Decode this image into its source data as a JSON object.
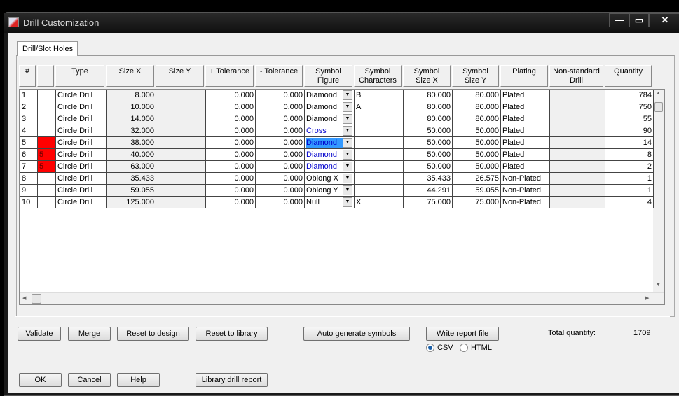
{
  "window": {
    "title": "Drill Customization",
    "minimize": "—",
    "maximize": "▭",
    "close": "✕"
  },
  "tab": "Drill/Slot Holes",
  "columns": [
    "#",
    "",
    "Type",
    "Size X",
    "Size Y",
    "+ Tolerance",
    "- Tolerance",
    "Symbol\nFigure",
    "Symbol\nCharacters",
    "Symbol\nSize X",
    "Symbol\nSize Y",
    "Plating",
    "Non-standard\nDrill",
    "Quantity"
  ],
  "rows": [
    {
      "n": "1",
      "mark": "",
      "markColor": "",
      "type": "Circle Drill",
      "sx": "8.000",
      "sy": "",
      "pt": "0.000",
      "mt": "0.000",
      "fig": "Diamond",
      "figStyle": "normal",
      "chars": "B",
      "ssx": "80.000",
      "ssy": "80.000",
      "plating": "Plated",
      "ns": "",
      "qty": "784"
    },
    {
      "n": "2",
      "mark": "",
      "markColor": "",
      "type": "Circle Drill",
      "sx": "10.000",
      "sy": "",
      "pt": "0.000",
      "mt": "0.000",
      "fig": "Diamond",
      "figStyle": "normal",
      "chars": "A",
      "ssx": "80.000",
      "ssy": "80.000",
      "plating": "Plated",
      "ns": "",
      "qty": "750"
    },
    {
      "n": "3",
      "mark": "",
      "markColor": "",
      "type": "Circle Drill",
      "sx": "14.000",
      "sy": "",
      "pt": "0.000",
      "mt": "0.000",
      "fig": "Diamond",
      "figStyle": "normal",
      "chars": "",
      "ssx": "80.000",
      "ssy": "80.000",
      "plating": "Plated",
      "ns": "",
      "qty": "55"
    },
    {
      "n": "4",
      "mark": "",
      "markColor": "",
      "type": "Circle Drill",
      "sx": "32.000",
      "sy": "",
      "pt": "0.000",
      "mt": "0.000",
      "fig": "Cross",
      "figStyle": "blue",
      "chars": "",
      "ssx": "50.000",
      "ssy": "50.000",
      "plating": "Plated",
      "ns": "",
      "qty": "90"
    },
    {
      "n": "5",
      "mark": "",
      "markColor": "#ff0000",
      "type": "Circle Drill",
      "sx": "38.000",
      "sy": "",
      "pt": "0.000",
      "mt": "0.000",
      "fig": "Diamond",
      "figStyle": "selected",
      "chars": "",
      "ssx": "50.000",
      "ssy": "50.000",
      "plating": "Plated",
      "ns": "",
      "qty": "14"
    },
    {
      "n": "6",
      "mark": "5",
      "markColor": "#ff0000",
      "type": "Circle Drill",
      "sx": "40.000",
      "sy": "",
      "pt": "0.000",
      "mt": "0.000",
      "fig": "Diamond",
      "figStyle": "blue",
      "chars": "",
      "ssx": "50.000",
      "ssy": "50.000",
      "plating": "Plated",
      "ns": "",
      "qty": "8"
    },
    {
      "n": "7",
      "mark": "5",
      "markColor": "#ff0000",
      "type": "Circle Drill",
      "sx": "63.000",
      "sy": "",
      "pt": "0.000",
      "mt": "0.000",
      "fig": "Diamond",
      "figStyle": "blue",
      "chars": "",
      "ssx": "50.000",
      "ssy": "50.000",
      "plating": "Plated",
      "ns": "",
      "qty": "2"
    },
    {
      "n": "8",
      "mark": "",
      "markColor": "",
      "type": "Circle Drill",
      "sx": "35.433",
      "sy": "",
      "pt": "0.000",
      "mt": "0.000",
      "fig": "Oblong X",
      "figStyle": "normal",
      "chars": "",
      "ssx": "35.433",
      "ssy": "26.575",
      "plating": "Non-Plated",
      "ns": "",
      "qty": "1"
    },
    {
      "n": "9",
      "mark": "",
      "markColor": "",
      "type": "Circle Drill",
      "sx": "59.055",
      "sy": "",
      "pt": "0.000",
      "mt": "0.000",
      "fig": "Oblong Y",
      "figStyle": "normal",
      "chars": "",
      "ssx": "44.291",
      "ssy": "59.055",
      "plating": "Non-Plated",
      "ns": "",
      "qty": "1"
    },
    {
      "n": "10",
      "mark": "",
      "markColor": "",
      "type": "Circle Drill",
      "sx": "125.000",
      "sy": "",
      "pt": "0.000",
      "mt": "0.000",
      "fig": "Null",
      "figStyle": "normal",
      "chars": "X",
      "ssx": "75.000",
      "ssy": "75.000",
      "plating": "Non-Plated",
      "ns": "",
      "qty": "4"
    }
  ],
  "buttons": {
    "validate": "Validate",
    "merge": "Merge",
    "reset_design": "Reset to design",
    "reset_library": "Reset to library",
    "auto_generate": "Auto generate symbols",
    "write_report": "Write report file",
    "ok": "OK",
    "cancel": "Cancel",
    "help": "Help",
    "library_report": "Library drill report"
  },
  "report_format": {
    "csv": "CSV",
    "html": "HTML",
    "selected": "CSV"
  },
  "total": {
    "label": "Total quantity:",
    "value": "1709"
  },
  "colors": {
    "selection": "#3399ff",
    "changed_text": "#0000cc",
    "mark": "#ff0000"
  }
}
